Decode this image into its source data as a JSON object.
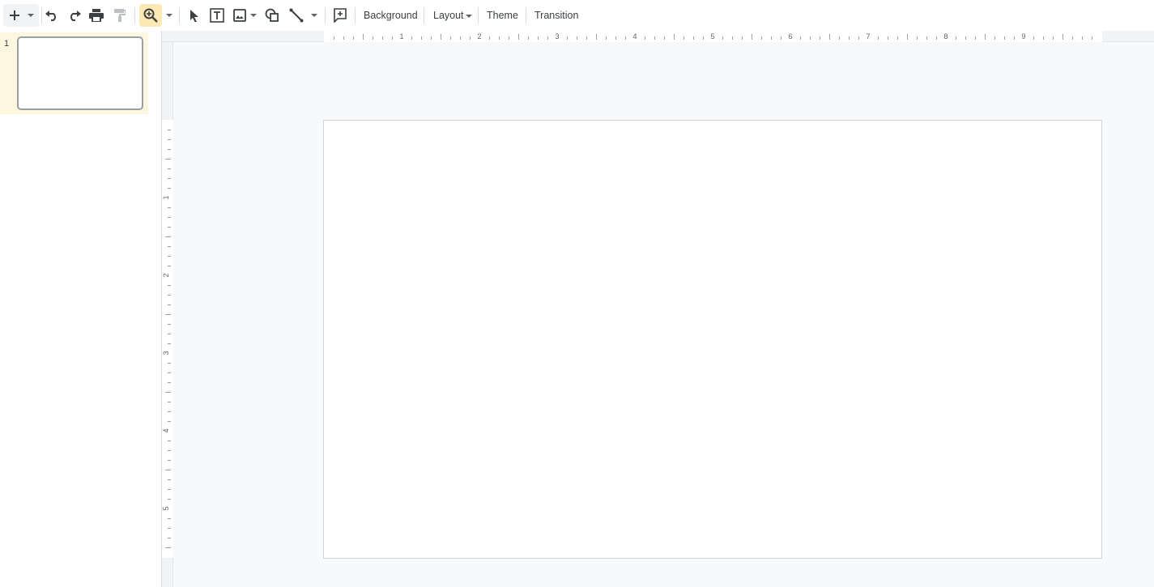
{
  "toolbar": {
    "buttons": [
      {
        "name": "new-slide",
        "icon": "plus-icon"
      },
      {
        "name": "new-slide-menu",
        "icon": "chevron-down-icon"
      },
      {
        "name": "undo",
        "icon": "undo-icon"
      },
      {
        "name": "redo",
        "icon": "redo-icon"
      },
      {
        "name": "print",
        "icon": "print-icon"
      },
      {
        "name": "paint-format",
        "icon": "paint-format-icon"
      },
      {
        "name": "zoom",
        "icon": "zoom-in-icon"
      },
      {
        "name": "zoom-menu",
        "icon": "chevron-down-icon"
      },
      {
        "name": "select",
        "icon": "cursor-icon"
      },
      {
        "name": "text-box",
        "icon": "text-box-icon"
      },
      {
        "name": "image",
        "icon": "image-icon"
      },
      {
        "name": "shape",
        "icon": "shape-icon"
      },
      {
        "name": "line",
        "icon": "line-icon"
      },
      {
        "name": "line-menu",
        "icon": "chevron-down-icon"
      },
      {
        "name": "comment",
        "icon": "add-comment-icon"
      }
    ],
    "background_label": "Background",
    "layout_label": "Layout",
    "theme_label": "Theme",
    "transition_label": "Transition",
    "active_color": "#fce8b2"
  },
  "filmstrip": {
    "slides": [
      {
        "number": "1"
      }
    ],
    "selected_color": "#fef7e0"
  },
  "rulers": {
    "horizontal_labels": [
      "1",
      "2",
      "3",
      "4",
      "5",
      "6",
      "7",
      "8",
      "9"
    ],
    "vertical_labels": [
      "1",
      "2",
      "3",
      "4",
      "5"
    ]
  }
}
